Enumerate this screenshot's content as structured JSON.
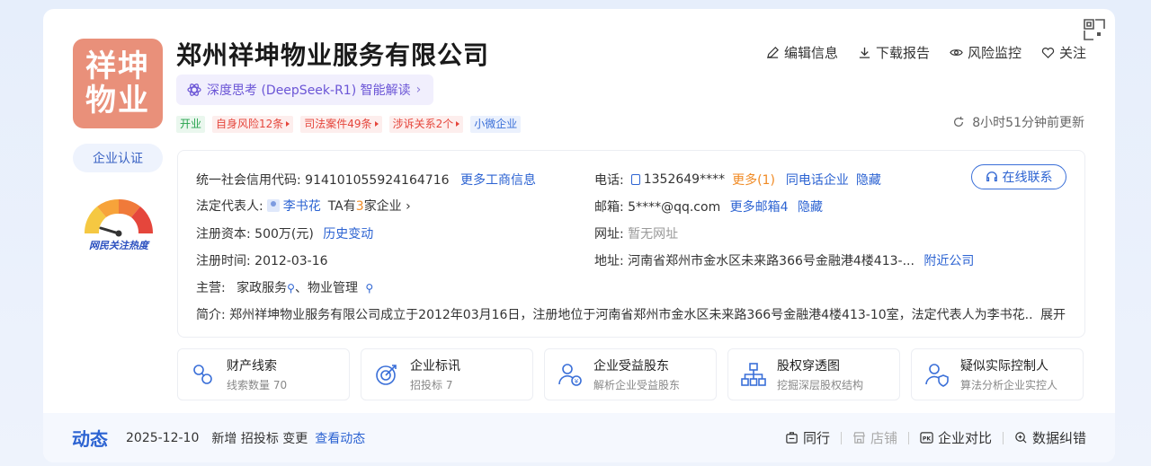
{
  "company": {
    "name": "郑州祥坤物业服务有限公司",
    "logo_line1": "祥坤",
    "logo_line2": "物业",
    "cert_label": "企业认证",
    "heat_label": "网民关注热度",
    "ai_label": "深度思考 (DeepSeek-R1) 智能解读"
  },
  "tags": [
    {
      "label": "开业",
      "tone": "green"
    },
    {
      "label": "自身风险12条",
      "tone": "red"
    },
    {
      "label": "司法案件49条",
      "tone": "red"
    },
    {
      "label": "涉诉关系2个",
      "tone": "red"
    },
    {
      "label": "小微企业",
      "tone": "blue"
    }
  ],
  "actions": {
    "edit": "编辑信息",
    "download": "下载报告",
    "monitor": "风险监控",
    "follow": "关注"
  },
  "updated": "8小时51分钟前更新",
  "info": {
    "credit_code_label": "统一社会信用代码:",
    "credit_code": "914101055924164716",
    "more_business": "更多工商信息",
    "legal_rep_label": "法定代表人:",
    "legal_rep": "李书花",
    "ta_prefix": "TA有",
    "ta_count": "3",
    "ta_suffix": "家企业",
    "capital_label": "注册资本:",
    "capital": "500万(元)",
    "history_change": "历史变动",
    "reg_time_label": "注册时间:",
    "reg_time": "2012-03-16",
    "business_label": "主营:",
    "business_1": "家政服务",
    "business_2": "、物业管理",
    "intro_label": "简介:",
    "intro": "郑州祥坤物业服务有限公司成立于2012年03月16日，注册地位于河南省郑州市金水区未来路366号金融港4楼413-10室，法定代表人为李书花..",
    "expand": "展开",
    "phone_label": "电话:",
    "phone": "1352649****",
    "phone_more": "更多(1)",
    "same_phone": "同电话企业",
    "hide": "隐藏",
    "email_label": "邮箱:",
    "email": "5****@qq.com",
    "more_email": "更多邮箱4",
    "website_label": "网址:",
    "website": "暂无网址",
    "address_label": "地址:",
    "address": "河南省郑州市金水区未来路366号金融港4楼413-...",
    "nearby": "附近公司",
    "online_contact": "在线联系"
  },
  "features": [
    {
      "title": "财产线索",
      "sub": "线索数量 70",
      "icon": "coins-icon"
    },
    {
      "title": "企业标讯",
      "sub": "招投标 7",
      "icon": "target-icon"
    },
    {
      "title": "企业受益股东",
      "sub": "解析企业受益股东",
      "icon": "beneficiary-icon"
    },
    {
      "title": "股权穿透图",
      "sub": "挖掘深层股权结构",
      "icon": "org-chart-icon"
    },
    {
      "title": "疑似实际控制人",
      "sub": "算法分析企业实控人",
      "icon": "controller-icon"
    }
  ],
  "dynamics": {
    "title": "动态",
    "date": "2025-12-10",
    "text": "新增 招投标 变更",
    "view": "查看动态"
  },
  "tools": {
    "peer": "同行",
    "store": "店铺",
    "compare": "企业对比",
    "correct": "数据纠错"
  },
  "colors": {
    "brand_blue": "#2c63d2",
    "logo_bg": "#e9907a",
    "risk_red": "#e5463c",
    "ok_green": "#27a34d"
  }
}
